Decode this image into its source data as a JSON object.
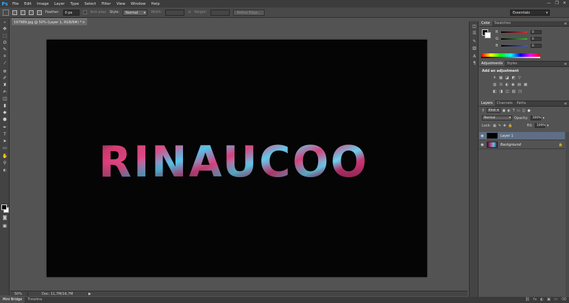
{
  "app": {
    "logo": "Ps"
  },
  "menu": [
    "File",
    "Edit",
    "Image",
    "Layer",
    "Type",
    "Select",
    "Filter",
    "View",
    "Window",
    "Help"
  ],
  "window_controls": [
    "—",
    "❐",
    "✕"
  ],
  "options": {
    "feather_label": "Feather:",
    "feather_value": "0 px",
    "antialias_label": "Anti-alias",
    "style_label": "Style:",
    "style_value": "Normal",
    "width_label": "Width:",
    "height_label": "Height:",
    "refine_label": "Refine Edge...",
    "workspace": "Essentials"
  },
  "document": {
    "tab_title": "197989.jpg @ 50% (Layer 1, RGB/8#) *",
    "close": "×",
    "canvas_text": "RINAUCOO"
  },
  "status": {
    "zoom": "50%",
    "doc": "Doc: 11,7M/16,7M"
  },
  "bottom_tabs": [
    "Mini Bridge",
    "Timeline"
  ],
  "color_panel": {
    "tabs": [
      "Color",
      "Swatches"
    ],
    "channels": [
      {
        "label": "R",
        "value": "0",
        "color": "#e53030"
      },
      {
        "label": "G",
        "value": "0",
        "color": "#34c134"
      },
      {
        "label": "B",
        "value": "0",
        "color": "#3b5be6"
      }
    ]
  },
  "adjustments_panel": {
    "tabs": [
      "Adjustments",
      "Styles"
    ],
    "title": "Add an adjustment",
    "row1": [
      "☀",
      "▦",
      "◪",
      "◩",
      "▽"
    ],
    "row2": [
      "▥",
      "⚖",
      "◐",
      "◉",
      "▤",
      "▦"
    ],
    "row3": [
      "◧",
      "◨",
      "◫",
      "▨",
      "◳"
    ]
  },
  "layers_panel": {
    "tabs": [
      "Layers",
      "Channels",
      "Paths"
    ],
    "kind_label": "Kind",
    "blend_mode": "Normal",
    "opacity_label": "Opacity:",
    "opacity_value": "100%",
    "lock_label": "Lock:",
    "fill_label": "Fill:",
    "fill_value": "100%",
    "layers": [
      {
        "name": "Layer 1",
        "selected": true
      },
      {
        "name": "Background",
        "selected": false,
        "locked": true
      }
    ],
    "footer_icons": [
      "⛓",
      "fx",
      "◐",
      "▣",
      "▭",
      "🗑"
    ]
  }
}
